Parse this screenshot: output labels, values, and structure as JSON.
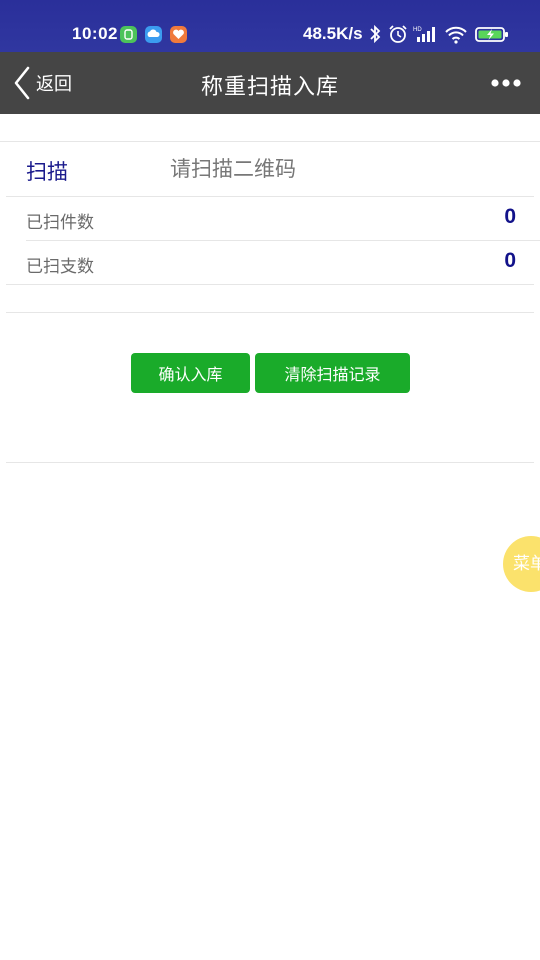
{
  "status_bar": {
    "time": "10:02",
    "network_speed": "48.5K/s",
    "app_icons": [
      "#4cc35a",
      "#3b9cf0",
      "#f07a3c"
    ],
    "icons": [
      "bluetooth-icon",
      "alarm-icon",
      "hd-signal-icon",
      "wifi-icon",
      "battery-charging-icon"
    ]
  },
  "header": {
    "back_label": "返回",
    "title": "称重扫描入库"
  },
  "scan": {
    "label": "扫描",
    "placeholder": "请扫描二维码",
    "value": ""
  },
  "counts": [
    {
      "label": "已扫件数",
      "value": "0"
    },
    {
      "label": "已扫支数",
      "value": "0"
    }
  ],
  "actions": {
    "confirm_label": "确认入库",
    "clear_label": "清除扫描记录"
  },
  "floating_menu": {
    "label": "菜单"
  },
  "colors": {
    "status_bar": "#3037a0",
    "title_bar": "#454545",
    "button_green": "#1aab2a",
    "label_blue": "#1a1a8c",
    "fab_yellow": "#fbe26c"
  }
}
